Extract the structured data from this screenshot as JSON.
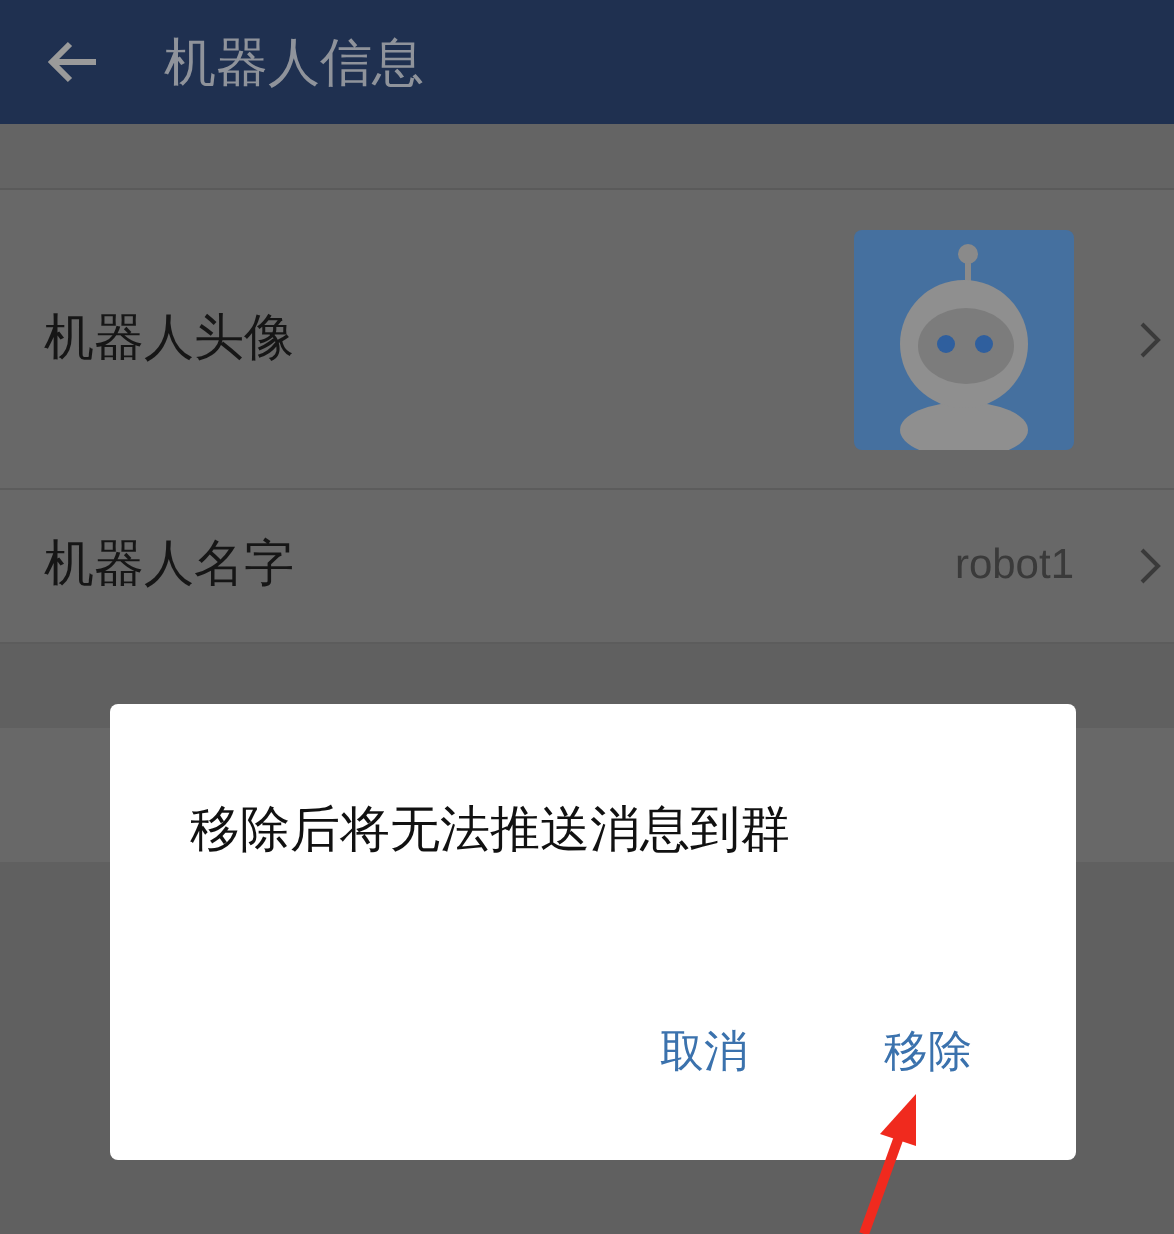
{
  "header": {
    "title": "机器人信息"
  },
  "rows": [
    {
      "kind": "avatar",
      "label": "机器人头像"
    },
    {
      "kind": "value",
      "label": "机器人名字",
      "value": "robot1"
    }
  ],
  "dialog": {
    "message": "移除后将无法推送消息到群",
    "buttons": [
      {
        "label": "取消"
      },
      {
        "label": "移除"
      }
    ]
  }
}
